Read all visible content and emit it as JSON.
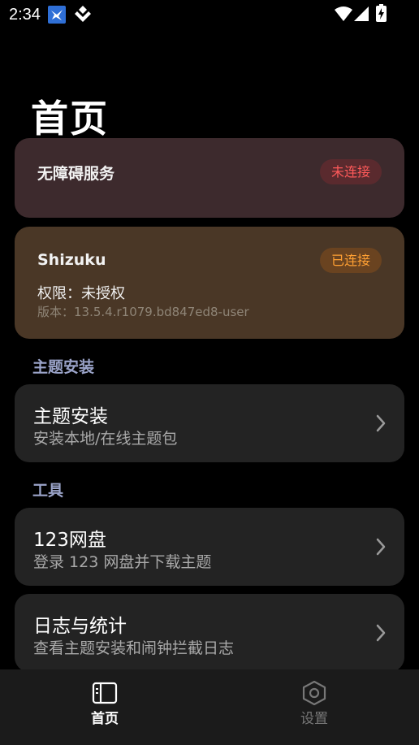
{
  "status_bar": {
    "time": "2:34"
  },
  "page_title": "首页",
  "accessibility": {
    "title": "无障碍服务",
    "status": "未连接"
  },
  "shizuku": {
    "title": "Shizuku",
    "status": "已连接",
    "permission": "权限：未授权",
    "version": "版本：13.5.4.r1079.bd847ed8-user"
  },
  "sections": {
    "theme_install": {
      "header": "主题安装",
      "items": [
        {
          "title": "主题安装",
          "subtitle": "安装本地/在线主题包"
        }
      ]
    },
    "tools": {
      "header": "工具",
      "items": [
        {
          "title": "123网盘",
          "subtitle": "登录 123 网盘并下载主题"
        },
        {
          "title": "日志与统计",
          "subtitle": "查看主题安装和闹钟拦截日志"
        }
      ]
    }
  },
  "bottom_nav": {
    "home_label": "首页",
    "settings_label": "设置"
  }
}
